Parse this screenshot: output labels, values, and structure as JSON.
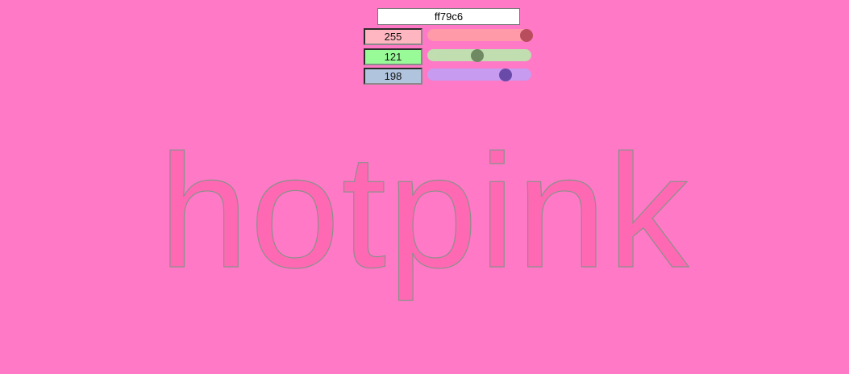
{
  "background_color": "#ff79c6",
  "hex_input": {
    "value": "ff79c6"
  },
  "channels": [
    {
      "name": "red",
      "value": "255",
      "fraction": 1.0,
      "field_color": "#ffb6c1",
      "track_color": "#ff9aa8",
      "thumb_color": "#b84d5e"
    },
    {
      "name": "green",
      "value": "121",
      "fraction": 0.4745,
      "field_color": "#98fb98",
      "track_color": "#c0deb0",
      "thumb_color": "#6f8a62"
    },
    {
      "name": "blue",
      "value": "198",
      "fraction": 0.7765,
      "field_color": "#b0c4de",
      "track_color": "#c69bf0",
      "thumb_color": "#6a4aa8"
    }
  ],
  "color_name": {
    "text": "hotpink",
    "fill_color": "#ff69b4"
  }
}
